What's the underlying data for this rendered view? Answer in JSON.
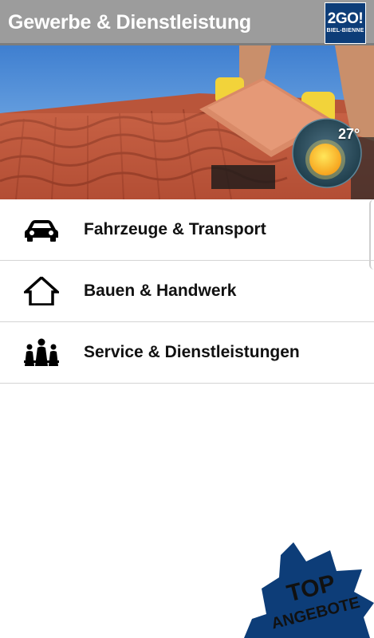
{
  "header": {
    "title": "Gewerbe & Dienstleistung"
  },
  "logo": {
    "main": "2GO!",
    "sub": "BIEL-BIENNE"
  },
  "weather": {
    "temperature": "27°",
    "icon": "sun-icon"
  },
  "menu": {
    "items": [
      {
        "label": "Fahrzeuge & Transport",
        "icon": "car-icon"
      },
      {
        "label": "Bauen & Handwerk",
        "icon": "house-icon"
      },
      {
        "label": "Service & Dienstleistungen",
        "icon": "group-service-icon"
      }
    ]
  },
  "badge": {
    "line1": "TOP",
    "line2": "ANGEBOTE"
  },
  "colors": {
    "header": "#9c9c9c",
    "logo": "#0d3d78",
    "badge": "#0d3d78"
  }
}
